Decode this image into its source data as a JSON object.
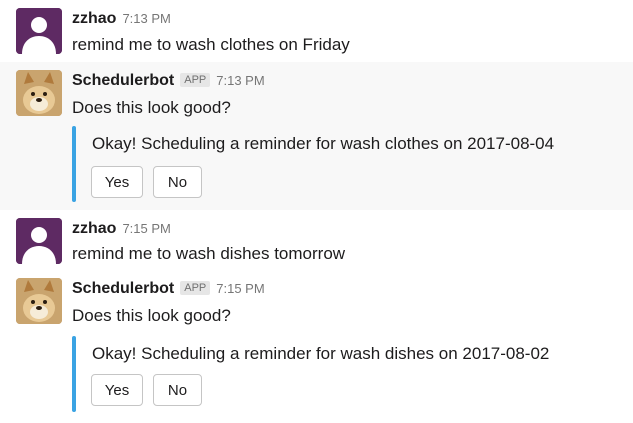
{
  "messages": [
    {
      "author": "zzhao",
      "badge": "",
      "time": "7:13 PM",
      "text": "remind me to wash clothes on Friday"
    },
    {
      "author": "Schedulerbot",
      "badge": "APP",
      "time": "7:13 PM",
      "text": "Does this look good?",
      "attachment": {
        "text": "Okay! Scheduling a reminder for wash clothes on 2017-08-04",
        "buttons": [
          "Yes",
          "No"
        ]
      }
    },
    {
      "author": "zzhao",
      "badge": "",
      "time": "7:15 PM",
      "text": "remind me to wash dishes tomorrow"
    },
    {
      "author": "Schedulerbot",
      "badge": "APP",
      "time": "7:15 PM",
      "text": "Does this look good?",
      "attachment": {
        "text": "Okay! Scheduling a reminder for wash dishes on 2017-08-02",
        "buttons": [
          "Yes",
          "No"
        ]
      }
    }
  ],
  "colors": {
    "user_avatar": "#5e2a63",
    "bot_avatar": "#b88a52",
    "attachment_bar": "#3aa3e3",
    "highlight_bg": "#f8f8f8"
  },
  "icons": {
    "user_avatar": "user-silhouette-icon",
    "bot_avatar": "doge-avatar-icon"
  }
}
